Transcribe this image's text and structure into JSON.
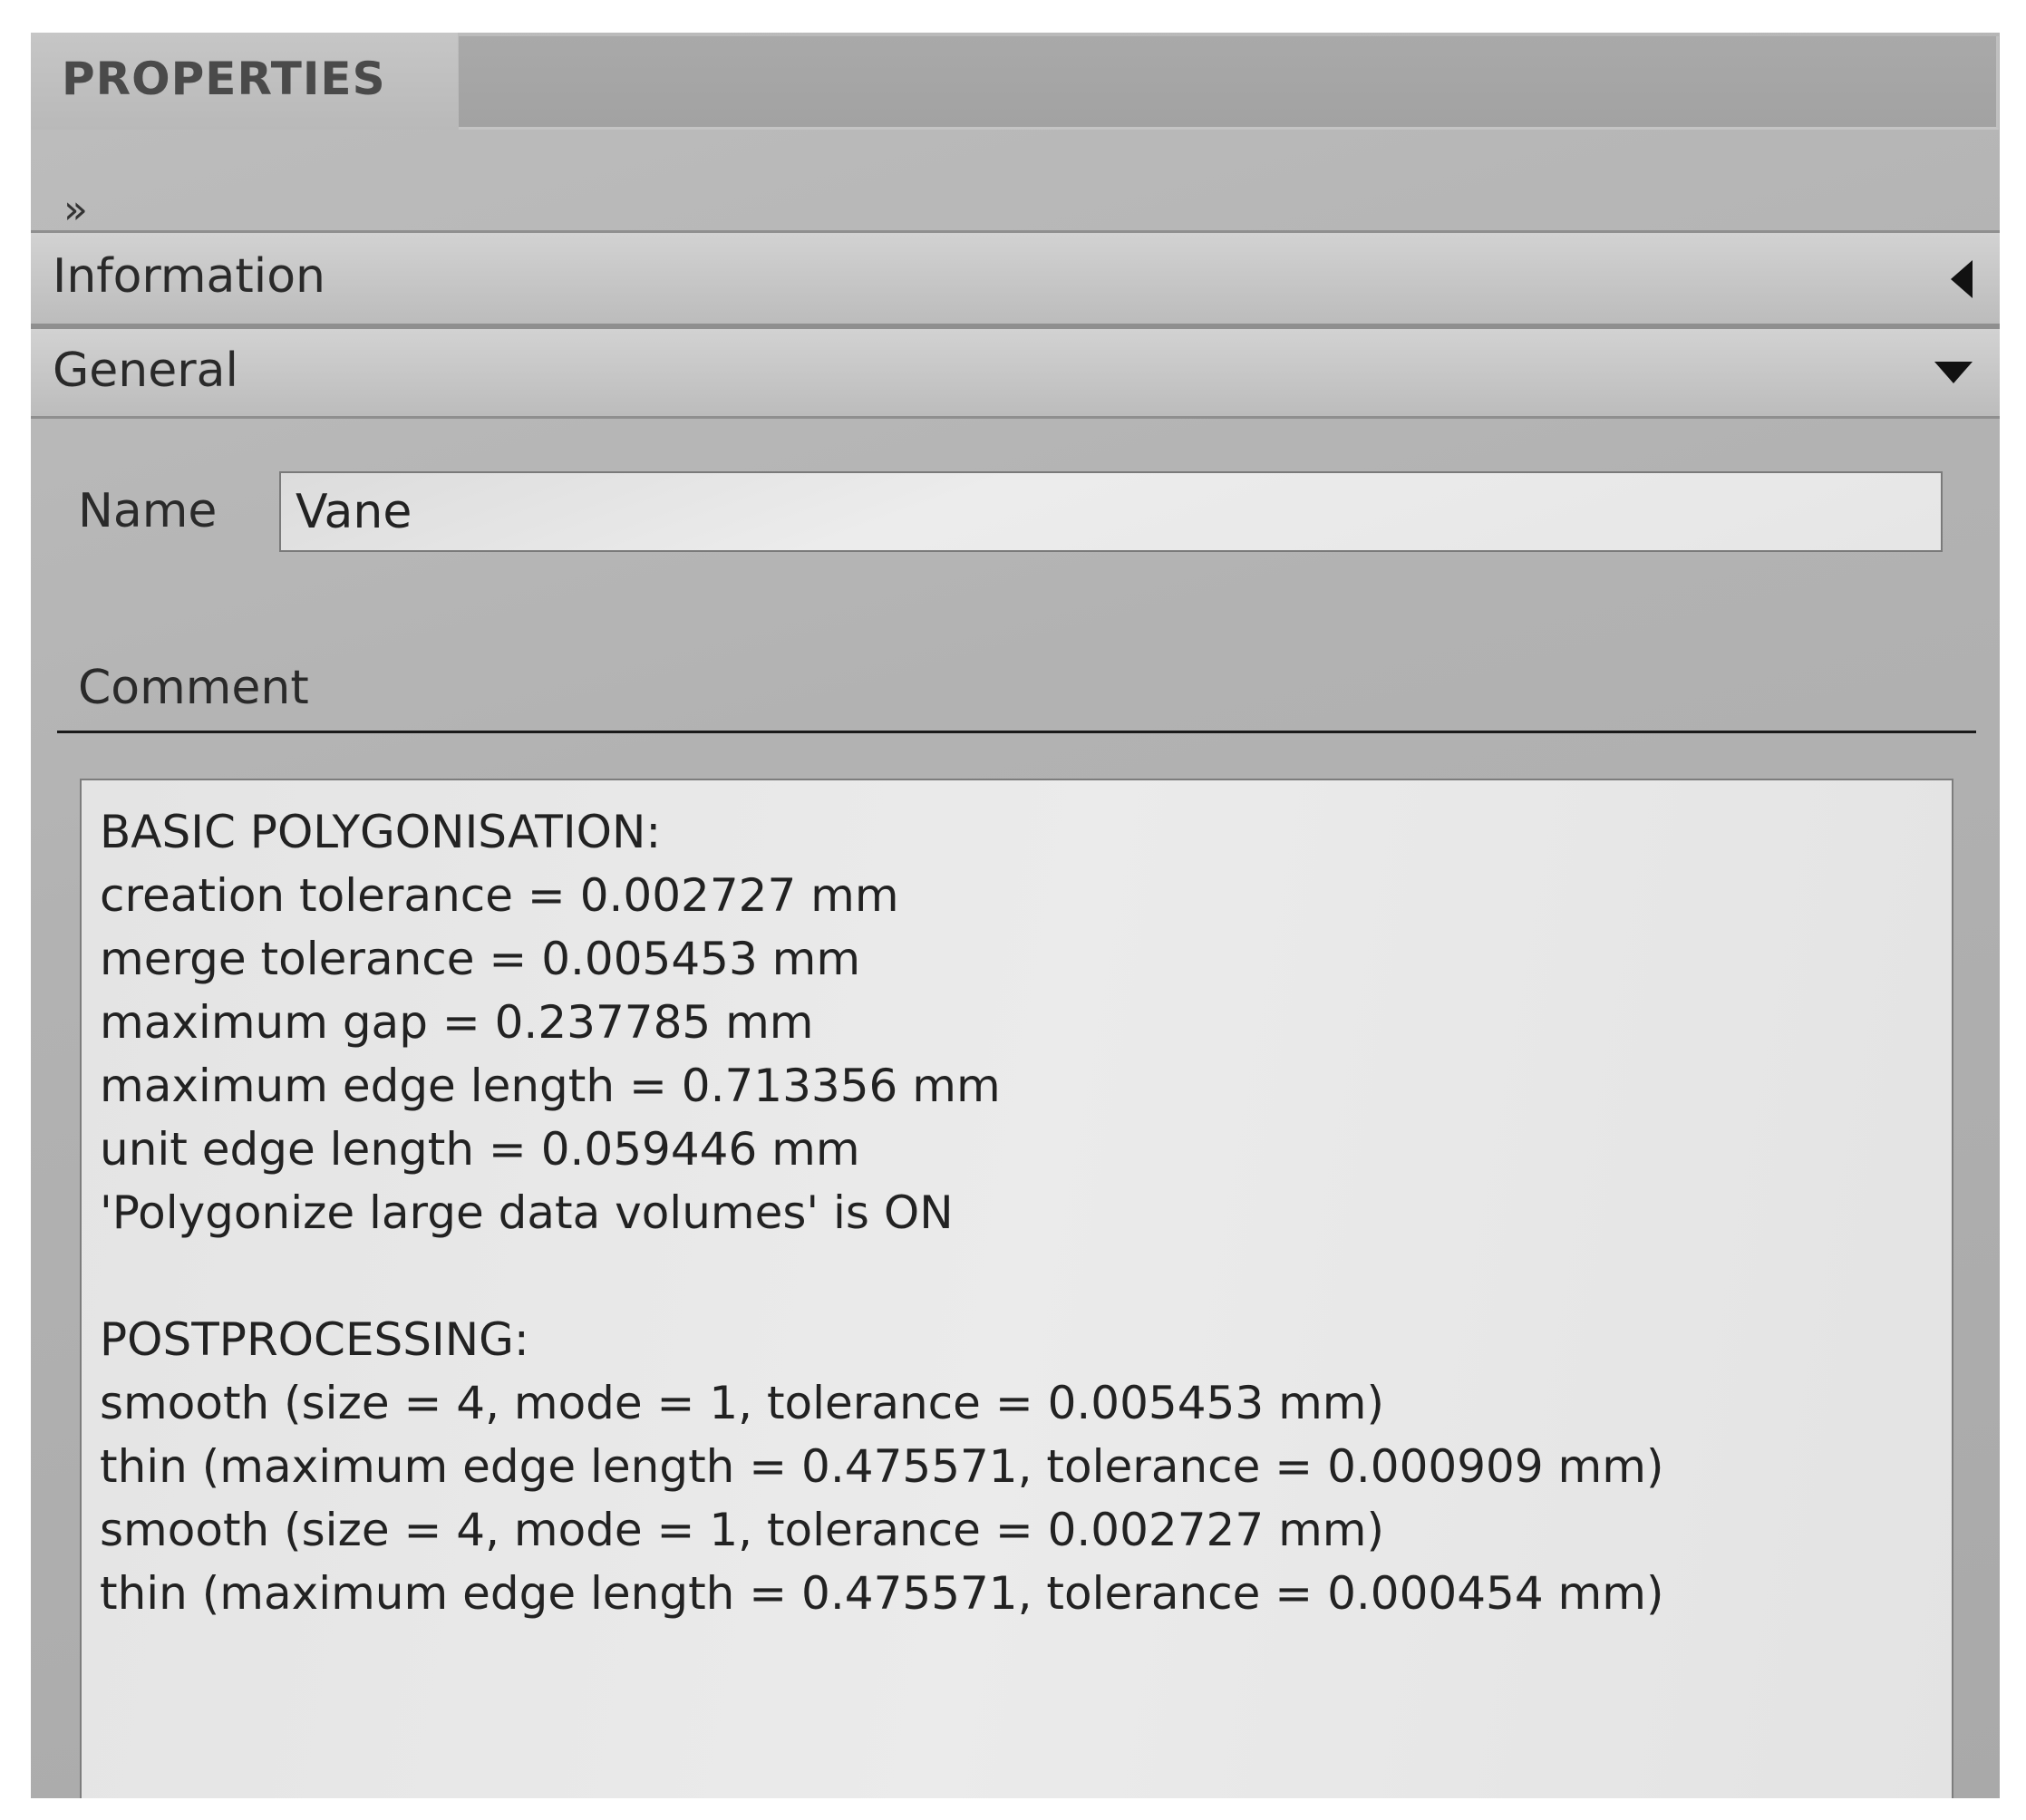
{
  "panel": {
    "tab_title": "PROPERTIES",
    "expand_icon": "»",
    "sections": [
      {
        "label": "Information",
        "state": "collapsed"
      },
      {
        "label": "General",
        "state": "expanded"
      }
    ]
  },
  "general": {
    "name_label": "Name",
    "name_value": "Vane",
    "comment_label": "Comment",
    "comment_lines": [
      "BASIC POLYGONISATION:",
      "creation tolerance = 0.002727 mm",
      "merge tolerance = 0.005453 mm",
      "maximum gap = 0.237785 mm",
      "maximum edge length = 0.713356 mm",
      "unit edge length = 0.059446 mm",
      "'Polygonize large data volumes' is ON",
      "",
      "POSTPROCESSING:",
      "smooth (size = 4, mode = 1, tolerance = 0.005453 mm)",
      "thin (maximum edge length = 0.475571, tolerance = 0.000909 mm)",
      "smooth (size = 4, mode = 1, tolerance = 0.002727 mm)",
      "thin (maximum edge length = 0.475571, tolerance = 0.000454 mm)"
    ]
  }
}
